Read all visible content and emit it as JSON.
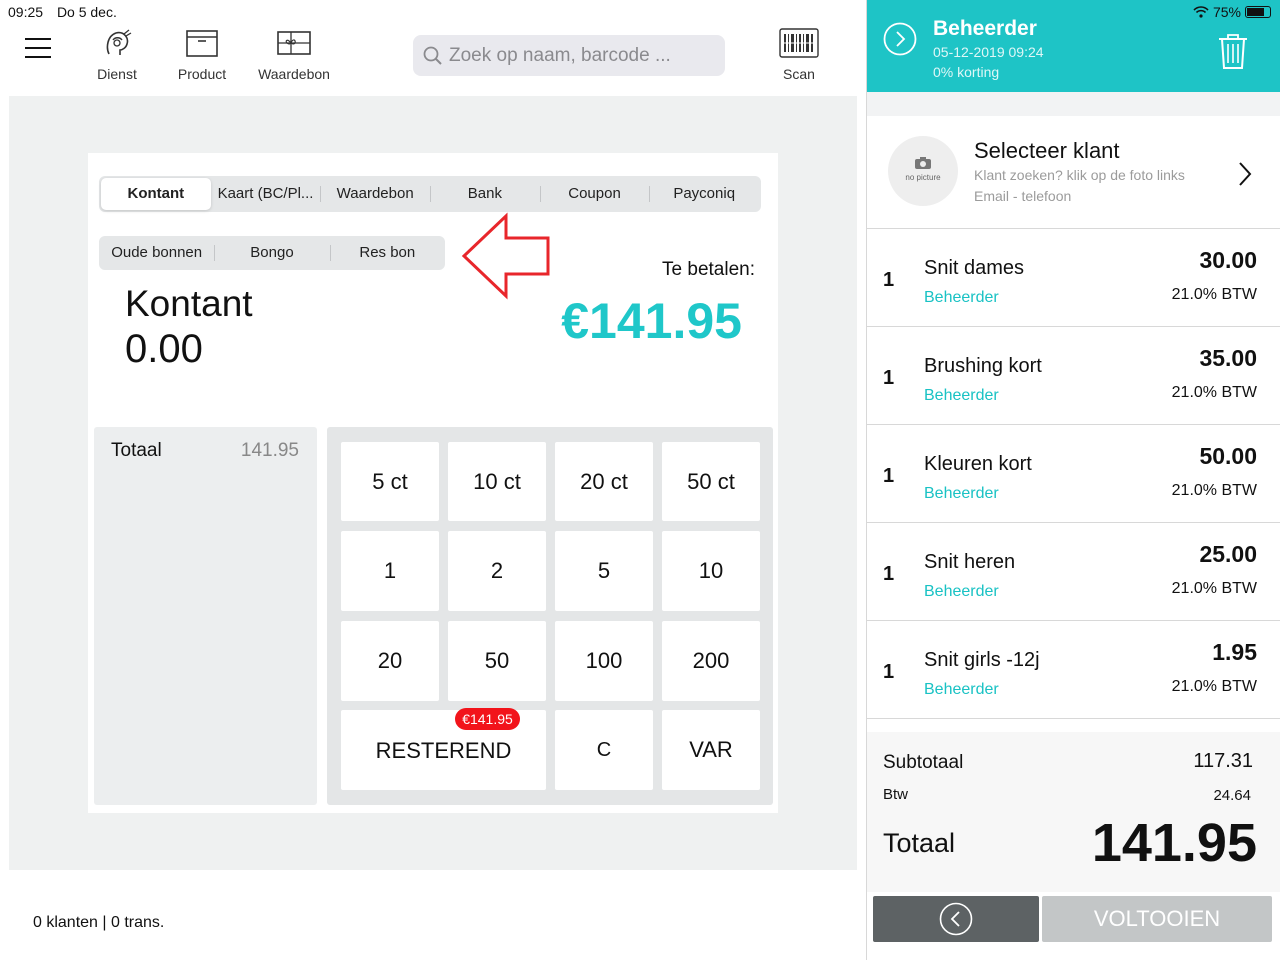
{
  "status": {
    "time": "09:25",
    "date": "Do 5 dec.",
    "battery": "75%"
  },
  "toolbar": {
    "dienst_label": "Dienst",
    "product_label": "Product",
    "waardebon_label": "Waardebon",
    "scan_label": "Scan",
    "search_placeholder": "Zoek op naam, barcode ..."
  },
  "payment": {
    "methods": [
      "Kontant",
      "Kaart (BC/Pl...",
      "Waardebon",
      "Bank",
      "Coupon",
      "Payconiq"
    ],
    "extra_methods": [
      "Oude bonnen",
      "Bongo",
      "Res bon"
    ],
    "selected_method": "Kontant",
    "entered_amount": "0.00",
    "due_label": "Te betalen:",
    "due_amount": "€141.95",
    "total_label": "Totaal",
    "total_value": "141.95"
  },
  "keypad": {
    "row1": [
      "5 ct",
      "10 ct",
      "20 ct",
      "50 ct"
    ],
    "row2": [
      "1",
      "2",
      "5",
      "10"
    ],
    "row3": [
      "20",
      "50",
      "100",
      "200"
    ],
    "remaining_label": "RESTEREND",
    "remaining_badge": "€141.95",
    "clear_label": "C",
    "var_label": "VAR"
  },
  "footer": {
    "stats": "0 klanten | 0 trans."
  },
  "ticket": {
    "user": "Beheerder",
    "datetime": "05-12-2019 09:24",
    "discount": "0% korting",
    "customer_title": "Selecteer klant",
    "customer_hint": "Klant zoeken? klik op de foto links",
    "customer_sub": "Email - telefoon",
    "avatar_text": "no picture",
    "lines": [
      {
        "qty": "1",
        "name": "Snit dames",
        "staff": "Beheerder",
        "price": "30.00",
        "vat": "21.0% BTW"
      },
      {
        "qty": "1",
        "name": "Brushing kort",
        "staff": "Beheerder",
        "price": "35.00",
        "vat": "21.0% BTW"
      },
      {
        "qty": "1",
        "name": "Kleuren kort",
        "staff": "Beheerder",
        "price": "50.00",
        "vat": "21.0% BTW"
      },
      {
        "qty": "1",
        "name": "Snit heren",
        "staff": "Beheerder",
        "price": "25.00",
        "vat": "21.0% BTW"
      },
      {
        "qty": "1",
        "name": "Snit girls -12j",
        "staff": "Beheerder",
        "price": "1.95",
        "vat": "21.0% BTW"
      }
    ],
    "subtotal_label": "Subtotaal",
    "subtotal": "117.31",
    "vat_label": "Btw",
    "vat": "24.64",
    "total_label": "Totaal",
    "total": "141.95",
    "complete_label": "VOLTOOIEN"
  },
  "colors": {
    "accent": "#1ec4c6",
    "badge": "#f2141b",
    "arrow": "#e8262b"
  }
}
